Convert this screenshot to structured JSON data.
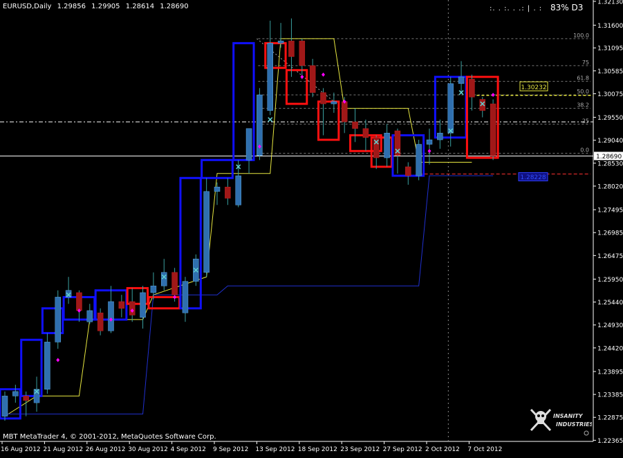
{
  "header": {
    "symbol": "EURUSD,Daily",
    "ohlc": [
      "1.29856",
      "1.29905",
      "1.28614",
      "1.28690"
    ]
  },
  "top_right": {
    "dots": ":. . :. . .: | . :",
    "status": "83% D3"
  },
  "footer": {
    "copyright": "MBT MetaTrader 4, © 2001-2012, MetaQuotes Software Corp."
  },
  "logo": {
    "line1": "INSANITY",
    "line2": "INDUSTRIES"
  },
  "colors": {
    "background": "#000000",
    "bull": "#2f6fae",
    "bear": "#a01818",
    "box_bull": "#1010ff",
    "box_bear": "#ff1010",
    "yellow": "#e8e840",
    "marker_pink": "#ff00ff",
    "marker_cyan": "#60d0d0"
  },
  "chart_data": {
    "type": "candlestick",
    "symbol": "EURUSD",
    "timeframe": "Daily",
    "ylim": [
      1.2234,
      1.3216
    ],
    "y_ticks": [
      "1.32130",
      "1.31600",
      "1.31095",
      "1.30585",
      "1.30075",
      "1.29550",
      "1.29040",
      "1.28530",
      "1.28020",
      "1.27495",
      "1.26985",
      "1.26475",
      "1.25950",
      "1.25440",
      "1.24930",
      "1.24420",
      "1.23895",
      "1.23385",
      "1.22875",
      "1.22365"
    ],
    "x_labels": [
      {
        "i": 0,
        "label": "16 Aug 2012"
      },
      {
        "i": 4,
        "label": "21 Aug 2012"
      },
      {
        "i": 8,
        "label": "26 Aug 2012"
      },
      {
        "i": 12,
        "label": "30 Aug 2012"
      },
      {
        "i": 16,
        "label": "4 Sep 2012"
      },
      {
        "i": 20,
        "label": "9 Sep 2012"
      },
      {
        "i": 24,
        "label": "13 Sep 2012"
      },
      {
        "i": 28,
        "label": "18 Sep 2012"
      },
      {
        "i": 32,
        "label": "23 Sep 2012"
      },
      {
        "i": 36,
        "label": "27 Sep 2012"
      },
      {
        "i": 40,
        "label": "2 Oct 2012"
      },
      {
        "i": 44,
        "label": "7 Oct 2012"
      }
    ],
    "candles": [
      {
        "o": 1.229,
        "h": 1.2345,
        "l": 1.228,
        "c": 1.2335
      },
      {
        "o": 1.2335,
        "h": 1.236,
        "l": 1.232,
        "c": 1.2345
      },
      {
        "o": 1.2335,
        "h": 1.2345,
        "l": 1.229,
        "c": 1.2325
      },
      {
        "o": 1.232,
        "h": 1.2378,
        "l": 1.23,
        "c": 1.235
      },
      {
        "o": 1.235,
        "h": 1.2475,
        "l": 1.234,
        "c": 1.2455
      },
      {
        "o": 1.2455,
        "h": 1.257,
        "l": 1.244,
        "c": 1.2555
      },
      {
        "o": 1.2555,
        "h": 1.26,
        "l": 1.254,
        "c": 1.257
      },
      {
        "o": 1.2565,
        "h": 1.257,
        "l": 1.25,
        "c": 1.2525
      },
      {
        "o": 1.25,
        "h": 1.254,
        "l": 1.2495,
        "c": 1.2525
      },
      {
        "o": 1.252,
        "h": 1.253,
        "l": 1.247,
        "c": 1.248
      },
      {
        "o": 1.248,
        "h": 1.258,
        "l": 1.2475,
        "c": 1.2545
      },
      {
        "o": 1.2545,
        "h": 1.256,
        "l": 1.251,
        "c": 1.253
      },
      {
        "o": 1.2545,
        "h": 1.2575,
        "l": 1.25,
        "c": 1.2515
      },
      {
        "o": 1.251,
        "h": 1.258,
        "l": 1.2485,
        "c": 1.2565
      },
      {
        "o": 1.2565,
        "h": 1.261,
        "l": 1.255,
        "c": 1.258
      },
      {
        "o": 1.258,
        "h": 1.264,
        "l": 1.257,
        "c": 1.261
      },
      {
        "o": 1.261,
        "h": 1.262,
        "l": 1.2545,
        "c": 1.256
      },
      {
        "o": 1.252,
        "h": 1.26,
        "l": 1.25,
        "c": 1.259
      },
      {
        "o": 1.259,
        "h": 1.265,
        "l": 1.258,
        "c": 1.264
      },
      {
        "o": 1.261,
        "h": 1.282,
        "l": 1.26,
        "c": 1.279
      },
      {
        "o": 1.279,
        "h": 1.281,
        "l": 1.276,
        "c": 1.28
      },
      {
        "o": 1.28,
        "h": 1.282,
        "l": 1.276,
        "c": 1.2775
      },
      {
        "o": 1.276,
        "h": 1.286,
        "l": 1.2755,
        "c": 1.2825
      },
      {
        "o": 1.286,
        "h": 1.2925,
        "l": 1.283,
        "c": 1.293
      },
      {
        "o": 1.287,
        "h": 1.302,
        "l": 1.286,
        "c": 1.3005
      },
      {
        "o": 1.297,
        "h": 1.317,
        "l": 1.296,
        "c": 1.312
      },
      {
        "o": 1.312,
        "h": 1.3165,
        "l": 1.311,
        "c": 1.3125
      },
      {
        "o": 1.3125,
        "h": 1.3175,
        "l": 1.3045,
        "c": 1.309
      },
      {
        "o": 1.3125,
        "h": 1.313,
        "l": 1.304,
        "c": 1.307
      },
      {
        "o": 1.307,
        "h": 1.3085,
        "l": 1.3,
        "c": 1.301
      },
      {
        "o": 1.301,
        "h": 1.302,
        "l": 1.2915,
        "c": 1.2985
      },
      {
        "o": 1.2985,
        "h": 1.301,
        "l": 1.2965,
        "c": 1.299
      },
      {
        "o": 1.299,
        "h": 1.3,
        "l": 1.292,
        "c": 1.2945
      },
      {
        "o": 1.2945,
        "h": 1.2975,
        "l": 1.29,
        "c": 1.293
      },
      {
        "o": 1.293,
        "h": 1.295,
        "l": 1.288,
        "c": 1.291
      },
      {
        "o": 1.291,
        "h": 1.2915,
        "l": 1.284,
        "c": 1.2865
      },
      {
        "o": 1.2865,
        "h": 1.294,
        "l": 1.2845,
        "c": 1.292
      },
      {
        "o": 1.2925,
        "h": 1.293,
        "l": 1.283,
        "c": 1.287
      },
      {
        "o": 1.2845,
        "h": 1.2855,
        "l": 1.2805,
        "c": 1.2825
      },
      {
        "o": 1.2825,
        "h": 1.2905,
        "l": 1.2815,
        "c": 1.2895
      },
      {
        "o": 1.2895,
        "h": 1.293,
        "l": 1.285,
        "c": 1.2905
      },
      {
        "o": 1.2905,
        "h": 1.295,
        "l": 1.2885,
        "c": 1.292
      },
      {
        "o": 1.292,
        "h": 1.3045,
        "l": 1.289,
        "c": 1.303
      },
      {
        "o": 1.303,
        "h": 1.308,
        "l": 1.301,
        "c": 1.3045
      },
      {
        "o": 1.304,
        "h": 1.305,
        "l": 1.297,
        "c": 1.3
      },
      {
        "o": 1.2995,
        "h": 1.3,
        "l": 1.2955,
        "c": 1.297
      },
      {
        "o": 1.2985,
        "h": 1.2995,
        "l": 1.286,
        "c": 1.2869
      }
    ],
    "boxes": [
      {
        "from": 0,
        "to": 1,
        "hi": 1.235,
        "lo": 1.2285,
        "color": "blue"
      },
      {
        "from": 2,
        "to": 3,
        "hi": 1.246,
        "lo": 1.2335,
        "color": "blue"
      },
      {
        "from": 4,
        "to": 5,
        "hi": 1.253,
        "lo": 1.2475,
        "color": "blue"
      },
      {
        "from": 6,
        "to": 8,
        "hi": 1.2555,
        "lo": 1.2505,
        "color": "blue"
      },
      {
        "from": 9,
        "to": 11,
        "hi": 1.257,
        "lo": 1.2505,
        "color": "blue"
      },
      {
        "from": 12,
        "to": 13,
        "hi": 1.2575,
        "lo": 1.254,
        "color": "red"
      },
      {
        "from": 14,
        "to": 16,
        "hi": 1.2555,
        "lo": 1.253,
        "color": "red"
      },
      {
        "from": 17,
        "to": 18,
        "hi": 1.282,
        "lo": 1.253,
        "color": "blue"
      },
      {
        "from": 19,
        "to": 21,
        "hi": 1.286,
        "lo": 1.282,
        "color": "blue"
      },
      {
        "from": 22,
        "to": 23,
        "hi": 1.312,
        "lo": 1.286,
        "color": "blue"
      },
      {
        "from": 25,
        "to": 26,
        "hi": 1.312,
        "lo": 1.3065,
        "color": "red"
      },
      {
        "from": 27,
        "to": 28,
        "hi": 1.306,
        "lo": 1.2985,
        "color": "red"
      },
      {
        "from": 30,
        "to": 31,
        "hi": 1.299,
        "lo": 1.2905,
        "color": "red"
      },
      {
        "from": 33,
        "to": 35,
        "hi": 1.2915,
        "lo": 1.288,
        "color": "red"
      },
      {
        "from": 35,
        "to": 36,
        "hi": 1.291,
        "lo": 1.2845,
        "color": "red"
      },
      {
        "from": 37,
        "to": 39,
        "hi": 1.2915,
        "lo": 1.2825,
        "color": "blue"
      },
      {
        "from": 41,
        "to": 43,
        "hi": 1.3045,
        "lo": 1.291,
        "color": "blue"
      },
      {
        "from": 44,
        "to": 46,
        "hi": 1.3045,
        "lo": 1.2865,
        "color": "red"
      }
    ],
    "markers": [
      {
        "i": 3,
        "y": 1.2345,
        "shape": "x"
      },
      {
        "i": 5,
        "y": 1.2415,
        "shape": "diamond"
      },
      {
        "i": 6,
        "y": 1.256,
        "shape": "x"
      },
      {
        "i": 7,
        "y": 1.2525,
        "shape": "diamond"
      },
      {
        "i": 10,
        "y": 1.2505,
        "shape": "diamond"
      },
      {
        "i": 12,
        "y": 1.2525,
        "shape": "diamond"
      },
      {
        "i": 15,
        "y": 1.26,
        "shape": "x"
      },
      {
        "i": 16,
        "y": 1.2555,
        "shape": "diamond"
      },
      {
        "i": 18,
        "y": 1.2615,
        "shape": "x"
      },
      {
        "i": 22,
        "y": 1.2845,
        "shape": "x"
      },
      {
        "i": 24,
        "y": 1.289,
        "shape": "diamond"
      },
      {
        "i": 25,
        "y": 1.295,
        "shape": "x"
      },
      {
        "i": 28,
        "y": 1.3045,
        "shape": "diamond"
      },
      {
        "i": 30,
        "y": 1.305,
        "shape": "diamond"
      },
      {
        "i": 32,
        "y": 1.299,
        "shape": "diamond"
      },
      {
        "i": 35,
        "y": 1.29,
        "shape": "x"
      },
      {
        "i": 37,
        "y": 1.288,
        "shape": "x"
      },
      {
        "i": 40,
        "y": 1.288,
        "shape": "diamond"
      },
      {
        "i": 42,
        "y": 1.2925,
        "shape": "x"
      },
      {
        "i": 43,
        "y": 1.301,
        "shape": "x"
      },
      {
        "i": 45,
        "y": 1.2985,
        "shape": "x"
      },
      {
        "i": 46,
        "y": 1.3005,
        "shape": "diamond"
      }
    ],
    "fib_levels": [
      {
        "label": "100.0",
        "value": 1.313
      },
      {
        "label": "75",
        "value": 1.307
      },
      {
        "label": "61.8",
        "value": 1.3035
      },
      {
        "label": "50.0",
        "value": 1.3005
      },
      {
        "label": "38.2",
        "value": 1.2975
      },
      {
        "label": "25",
        "value": 1.294
      },
      {
        "label": "0.0",
        "value": 1.2875
      }
    ],
    "horizontal_lines": [
      {
        "value": 1.2869,
        "color": "white",
        "style": "solid",
        "label": "1.28690"
      },
      {
        "value": 1.2945,
        "color": "white",
        "style": "dashdot"
      },
      {
        "value": 1.3004,
        "color": "yellow",
        "style": "dashed"
      }
    ],
    "price_labels": [
      {
        "value": 1.30232,
        "text": "1.30232",
        "style": "yellow"
      },
      {
        "value": 1.28228,
        "text": "1.28228",
        "style": "blue"
      }
    ],
    "vertical_line_at_index": 41
  }
}
